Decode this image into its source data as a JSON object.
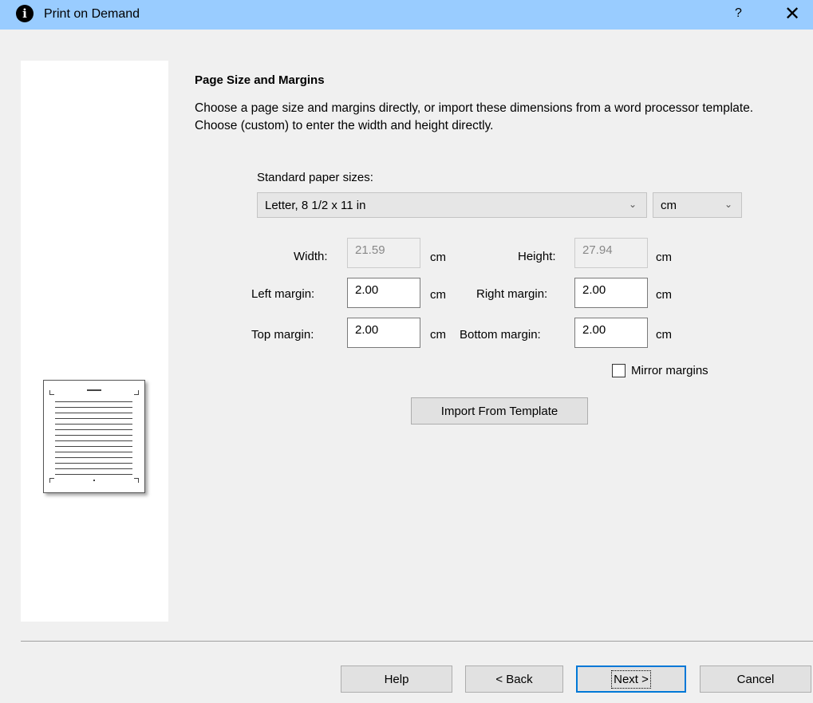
{
  "window": {
    "title": "Print on Demand",
    "help_symbol": "?",
    "close_symbol": "✕"
  },
  "icons": {
    "app_icon_glyph": "i"
  },
  "section": {
    "heading": "Page Size and Margins",
    "description": "Choose a page size and margins directly, or import these dimensions from a word processor template. Choose (custom) to enter the width and height directly."
  },
  "paper": {
    "label": "Standard paper sizes:",
    "selected": "Letter, 8 1/2 x 11 in",
    "unit_selected": "cm"
  },
  "fields": {
    "width": {
      "label": "Width:",
      "value": "21.59",
      "unit": "cm",
      "disabled": true
    },
    "height": {
      "label": "Height:",
      "value": "27.94",
      "unit": "cm",
      "disabled": true
    },
    "left_margin": {
      "label": "Left margin:",
      "value": "2.00",
      "unit": "cm"
    },
    "right_margin": {
      "label": "Right margin:",
      "value": "2.00",
      "unit": "cm"
    },
    "top_margin": {
      "label": "Top margin:",
      "value": "2.00",
      "unit": "cm"
    },
    "bottom_margin": {
      "label": "Bottom margin:",
      "value": "2.00",
      "unit": "cm"
    }
  },
  "mirror": {
    "label": "Mirror margins",
    "checked": false
  },
  "buttons": {
    "import": "Import From Template",
    "help": "Help",
    "back": "< Back",
    "next": "Next >",
    "cancel": "Cancel"
  }
}
